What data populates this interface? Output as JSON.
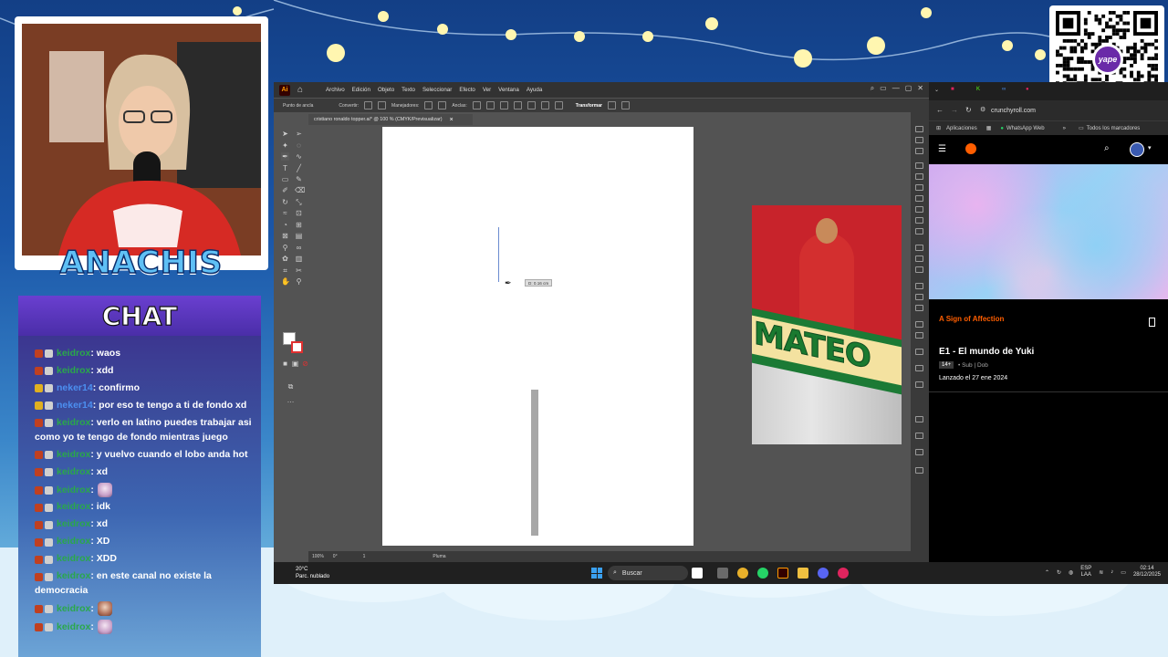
{
  "overlay": {
    "streamer_name": "ANACHIS",
    "chat_title": "CHAT",
    "qr_logo_text": "yape"
  },
  "chat": [
    {
      "user": "keidrox",
      "color": "green",
      "text": ": waos"
    },
    {
      "user": "keidrox",
      "color": "green",
      "text": ": xdd"
    },
    {
      "user": "neker14",
      "color": "blue",
      "text": ": confirmo"
    },
    {
      "user": "neker14",
      "color": "blue",
      "text": ": por eso te tengo a ti de fondo xd"
    },
    {
      "user": "keidrox",
      "color": "green",
      "text": ": verlo en latino puedes trabajar asi como yo te tengo de fondo mientras juego"
    },
    {
      "user": "keidrox",
      "color": "green",
      "text": ": y vuelvo cuando el lobo anda hot"
    },
    {
      "user": "keidrox",
      "color": "green",
      "text": ": xd"
    },
    {
      "user": "keidrox",
      "color": "green",
      "text": ":",
      "emote": "pink"
    },
    {
      "user": "keidrox",
      "color": "green",
      "text": ": idk"
    },
    {
      "user": "keidrox",
      "color": "green",
      "text": ": xd"
    },
    {
      "user": "keidrox",
      "color": "green",
      "text": ": XD"
    },
    {
      "user": "keidrox",
      "color": "green",
      "text": ": XDD"
    },
    {
      "user": "keidrox",
      "color": "green",
      "text": ": en este canal no existe la democracia"
    },
    {
      "user": "keidrox",
      "color": "green",
      "text": ":",
      "emote": "brown"
    },
    {
      "user": "keidrox",
      "color": "green",
      "text": ":",
      "emote": "pink"
    }
  ],
  "illustrator": {
    "logo": "Ai",
    "menus": [
      "Archivo",
      "Edición",
      "Objeto",
      "Texto",
      "Seleccionar",
      "Efecto",
      "Ver",
      "Ventana",
      "Ayuda"
    ],
    "control": {
      "anchor_label": "Punto de ancla",
      "convert_label": "Convertir:",
      "handles_label": "Manejadores:",
      "anchors_label": "Anclas:",
      "transform_label": "Transformar"
    },
    "doc_tab": "cristiano ronaldo topper.ai* @ 100 % (CMYK/Previsualizar)",
    "doc_close": "×",
    "measure_tooltip": "D: 0.16 cm",
    "reference_text": "MATEO",
    "status": {
      "zoom": "100%",
      "rotation": "0°",
      "artboard": "1",
      "tool": "Pluma"
    }
  },
  "browser": {
    "url": "crunchyroll.com",
    "bookmarks": [
      "Aplicaciones",
      "WhatsApp Web",
      "Todos los marcadores"
    ],
    "show_title": "A Sign of Affection",
    "episode_title": "E1 - El mundo de Yuki",
    "rating": "14+",
    "sub_dub": "• Sub | Dob",
    "release": "Lanzado el 27 ene 2024"
  },
  "taskbar": {
    "temp": "20°C",
    "weather": "Parc. nublado",
    "search": "Buscar",
    "lang_top": "ESP",
    "lang_bottom": "LAA",
    "time": "02:14",
    "date": "28/12/2025"
  },
  "colors": {
    "accent_orange": "#ff5e00",
    "chat_green": "#2aa84a",
    "chat_blue": "#4c8ff0",
    "chat_header": "#6a3fd0"
  }
}
